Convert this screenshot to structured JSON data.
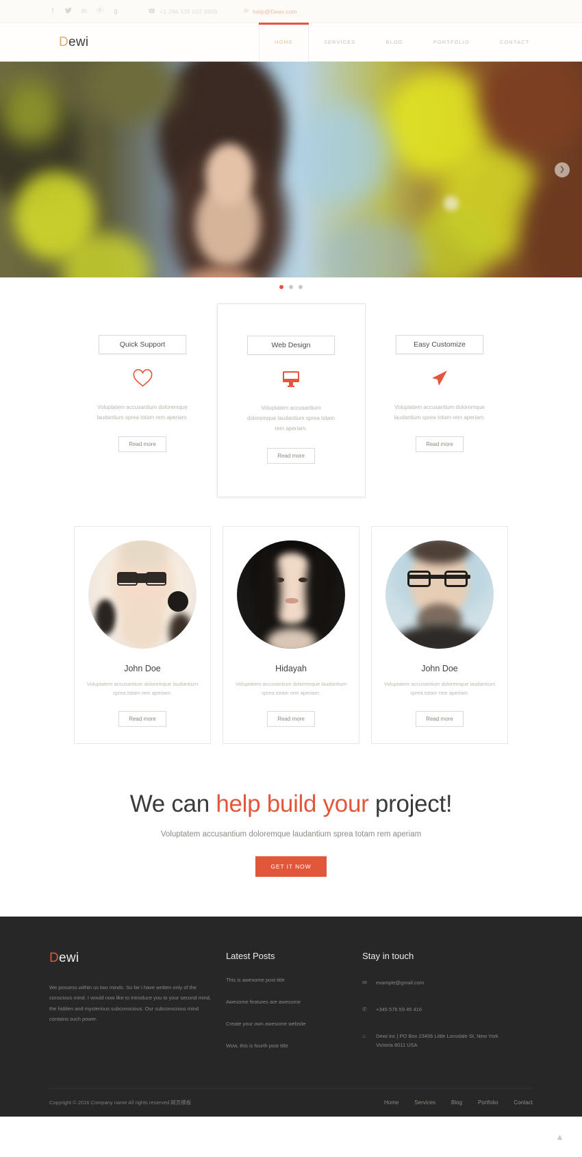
{
  "topbar": {
    "social": [
      {
        "name": "facebook-icon",
        "glyph": "f"
      },
      {
        "name": "twitter-icon",
        "glyph": "✉"
      },
      {
        "name": "linkedin-icon",
        "glyph": "in"
      },
      {
        "name": "pinterest-icon",
        "glyph": "Ⓟ"
      },
      {
        "name": "google-plus-icon",
        "glyph": "g"
      }
    ],
    "phone": {
      "icon": "phone-icon",
      "text": "+1 786 535 022 8899"
    },
    "email": {
      "icon": "mail-icon",
      "text": "help@Dewi.com"
    }
  },
  "header": {
    "brand_accent": "D",
    "brand_rest": "ewi",
    "nav": [
      {
        "label": "HOME",
        "active": true
      },
      {
        "label": "SERVICES",
        "active": false
      },
      {
        "label": "BLOG",
        "active": false
      },
      {
        "label": "PORTFOLIO",
        "active": false
      },
      {
        "label": "CONTACT",
        "active": false
      }
    ]
  },
  "hero": {
    "next_arrow": "❯",
    "dots": [
      true,
      false,
      false
    ]
  },
  "services": [
    {
      "title": "Quick Support",
      "icon": "heart-icon",
      "text": "Voluptatem accusantium doloremque laudantium sprea totam rem aperiam.",
      "button": "Read more",
      "featured": false
    },
    {
      "title": "Web Design",
      "icon": "monitor-icon",
      "text": "Voluptatem accusantium doloremque laudantium sprea totam rem aperiam.",
      "button": "Read more",
      "featured": true
    },
    {
      "title": "Easy Customize",
      "icon": "paper-plane-icon",
      "text": "Voluptatem accusantium doloremque laudantium sprea totam rem aperiam.",
      "button": "Read more",
      "featured": false
    }
  ],
  "team": [
    {
      "name": "John Doe",
      "text": "Voluptatem accusantium doloremque laudantium sprea totam rem aperiam.",
      "button": "Read more"
    },
    {
      "name": "Hidayah",
      "text": "Voluptatem accusantium doloremque laudantium sprea totam rem aperiam.",
      "button": "Read more"
    },
    {
      "name": "John Doe",
      "text": "Voluptatem accusantium doloremque laudantium sprea totam rem aperiam.",
      "button": "Read more"
    }
  ],
  "cta": {
    "heading_pre": "We can ",
    "heading_highlight": "help build your",
    "heading_post": " project!",
    "subtitle": "Voluptatem accusantium doloremque laudantium sprea totam rem aperiam",
    "button": "GET IT NOW"
  },
  "footer": {
    "about": {
      "brand_accent": "D",
      "brand_rest": "ewi",
      "text": "We possess within us two minds. So far i have written only of the conscious mind. I would now like to introduce you to your second mind, the hidden and mysterious subconscious. Our subconscious mind contains such power."
    },
    "posts": {
      "heading": "Latest Posts",
      "items": [
        "This is awesome post title",
        "Awesome features are awesome",
        "Create your own awesome website",
        "Wow, this is fourth post title"
      ]
    },
    "touch": {
      "heading": "Stay in touch",
      "items": [
        {
          "icon": "mail-icon",
          "glyph": "✉",
          "text": "example@gmail.com"
        },
        {
          "icon": "phone-icon",
          "glyph": "✆",
          "text": "+345 576 59 45 416"
        },
        {
          "icon": "building-icon",
          "glyph": "⌂",
          "text": "Dewi inc | PO Box 23456 Little Lonsdale St, New York\nVictoria 8011 USA"
        }
      ]
    },
    "copyright": "Copyright © 2016 Company name All rights reserved.网页模板",
    "nav": [
      "Home",
      "Services",
      "Blog",
      "Portfolio",
      "Contact"
    ],
    "to_top_icon": "▲"
  },
  "colors": {
    "accent": "#e2573b",
    "brand_gold": "#e0a96d",
    "footer_bg": "#272727"
  }
}
